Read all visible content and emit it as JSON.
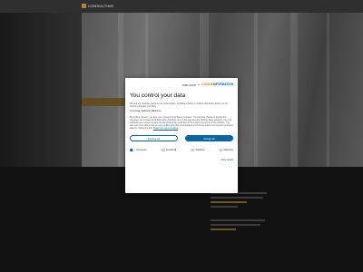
{
  "brand": {
    "logo_text": "CONSULTING"
  },
  "modal": {
    "brand_one": "one.com",
    "brand_plus": "+",
    "brand_two_a": "COOKIE",
    "brand_two_b": "INFORMATION",
    "title": "You control your data",
    "intro": "We and our business partners use technologies, including cookies, to collect information about you for various purposes, including:",
    "purposes": "Functional, Statistical, Marketing",
    "body": "By clicking 'Accept', you give your consent for all these purposes. You can also choose to specify the purposes you consent to by ticking the checkbox next to the purpose and clicking 'Save settings'. You may withdraw your consent at any time by clicking the small icon at the bottom left corner of the website. You can read more about how we use cookies and other technologies and how we collect and process personal data by clicking the link.",
    "more_link": "Read more about cookies",
    "decline_label": "Decline all",
    "accept_label": "Accept all",
    "toggles": [
      {
        "label": "Necessary",
        "on": true
      },
      {
        "label": "Functional",
        "on": false
      },
      {
        "label": "Statistics",
        "on": false
      },
      {
        "label": "Marketing",
        "on": false
      }
    ],
    "details_label": "Show details"
  }
}
